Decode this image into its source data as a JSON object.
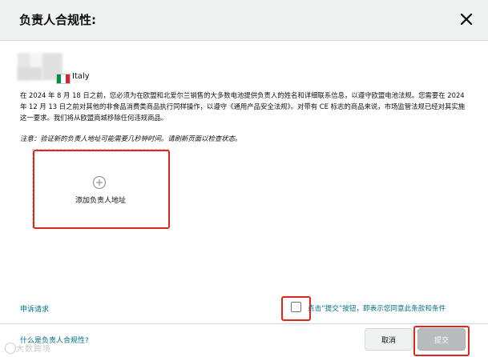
{
  "dialog": {
    "title": "负责人合规性:"
  },
  "manufacturer": {
    "country": "Italy",
    "flag_colors": [
      "#009246",
      "#ffffff",
      "#ce2b37"
    ]
  },
  "info_text": "在 2024 年 8 月 18 日之前，您必须为在欧盟和北爱尔兰销售的大多数电池提供负责人的姓名和详细联系信息，以遵守欧盟电池法规。您需要在 2024 年 12 月 13 日之前对其他的非食品消费类商品执行同样操作，以遵守《通用产品安全法规》。对带有 CE 标志的商品来说，市场监管法规已经对其实施这一要求。我们将从欧盟商城移除任何违规商品。",
  "note": {
    "label": "注意：",
    "text": "验证新的负责人地址可能需要几秒钟时间。请刷新页面以检查状态。"
  },
  "add_card": {
    "label": "添加负责人地址"
  },
  "links": {
    "appeal": "申诉请求",
    "what_is": "什么是负责人合规性?"
  },
  "consent": {
    "link_text": "点击“提交”按钮，即表示您同意此条款和条件"
  },
  "buttons": {
    "cancel": "取消",
    "submit": "提交"
  },
  "watermark": "大数跨境",
  "colors": {
    "highlight": "#e0261c",
    "link": "#007185"
  }
}
